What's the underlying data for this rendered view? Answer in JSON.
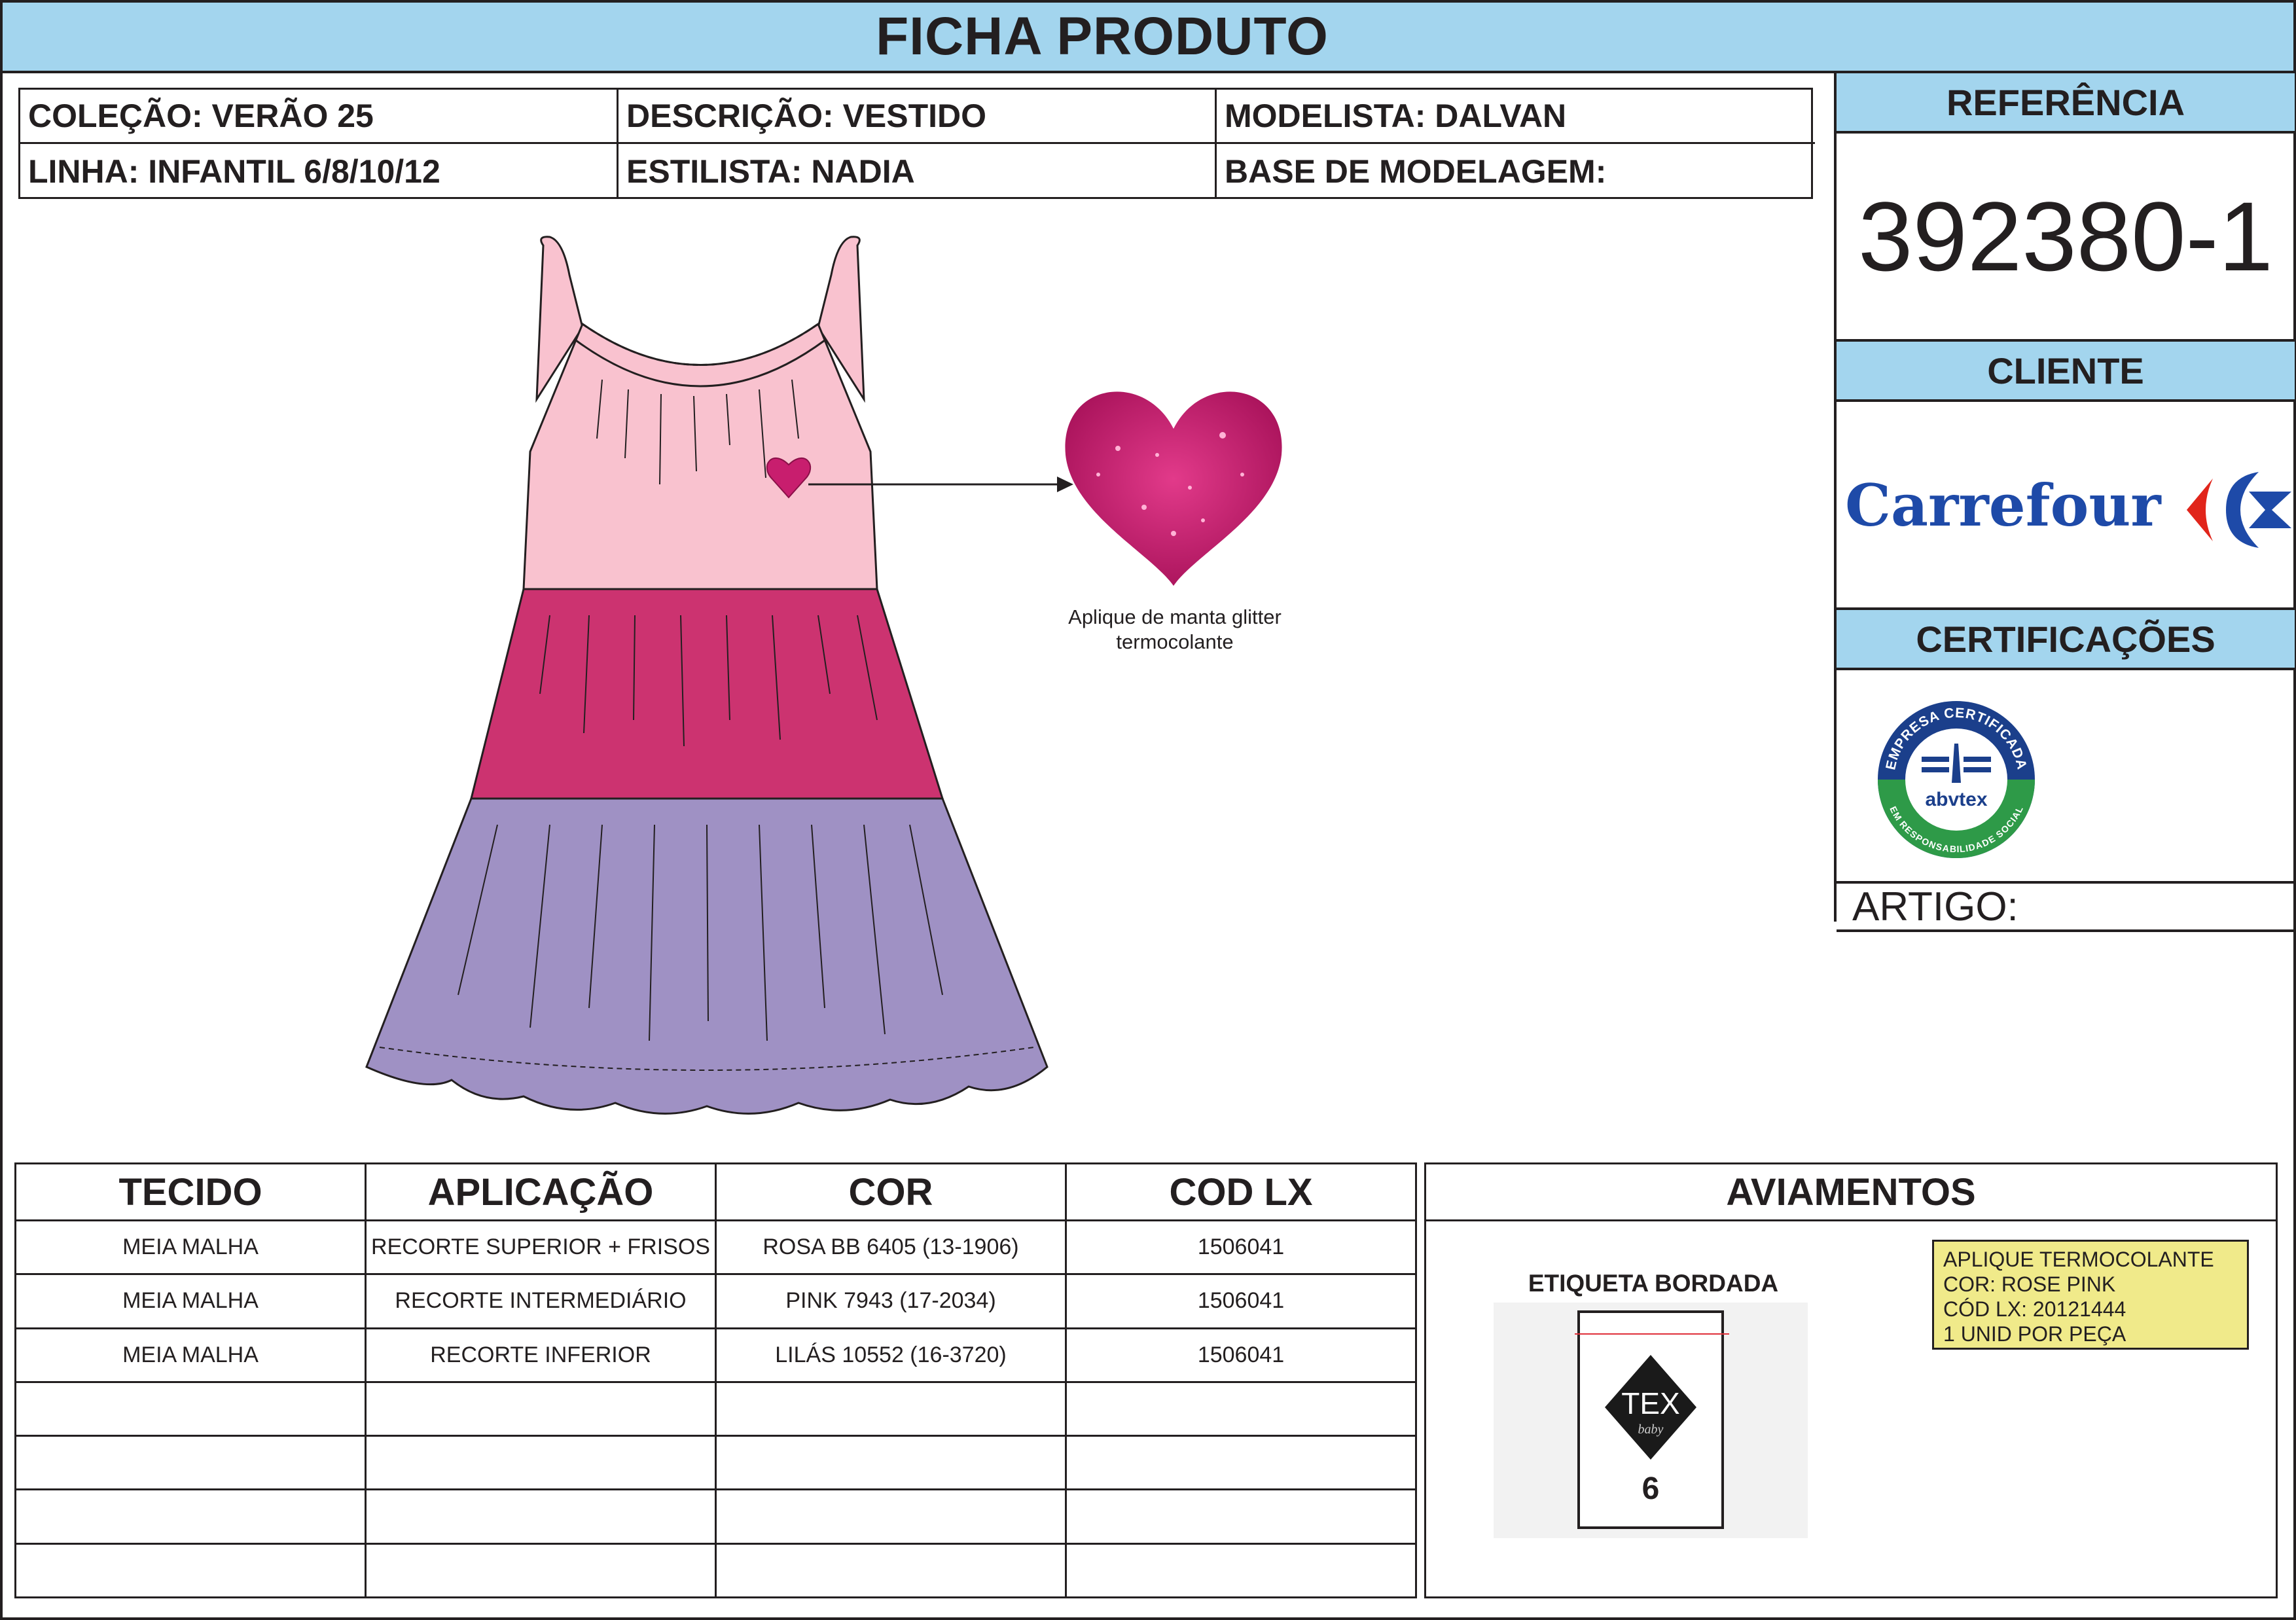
{
  "header": {
    "title": "FICHA PRODUTO"
  },
  "info": {
    "colecao": "COLEÇÃO: VERÃO 25",
    "descricao": "DESCRIÇÃO: VESTIDO",
    "modelista": "MODELISTA: DALVAN",
    "linha": "LINHA: INFANTIL 6/8/10/12",
    "estilista": "ESTILISTA: NADIA",
    "base": "BASE DE MODELAGEM:"
  },
  "side": {
    "referencia_label": "REFERÊNCIA",
    "referencia_value": "392380-1",
    "cliente_label": "CLIENTE",
    "cliente_logo_text": "Carrefour",
    "certificacoes_label": "CERTIFICAÇÕES",
    "seal_top": "EMPRESA CERTIFICADA",
    "seal_bottom": "EM RESPONSABILIDADE SOCIAL",
    "seal_brand": "abvtex",
    "artigo_label": "ARTIGO:"
  },
  "illustration": {
    "caption_line1": "Aplique de manta glitter",
    "caption_line2": "termocolante",
    "colors": {
      "top": "#f9c2cf",
      "middle": "#cc3370",
      "bottom": "#9f91c4",
      "heart": "#c81e6e"
    }
  },
  "fabric_table": {
    "headers": [
      "TECIDO",
      "APLICAÇÃO",
      "COR",
      "COD LX"
    ],
    "rows": [
      [
        "MEIA MALHA",
        "RECORTE SUPERIOR + FRISOS",
        "ROSA BB 6405 (13-1906)",
        "1506041"
      ],
      [
        "MEIA MALHA",
        "RECORTE INTERMEDIÁRIO",
        "PINK 7943 (17-2034)",
        "1506041"
      ],
      [
        "MEIA MALHA",
        "RECORTE INFERIOR",
        "LILÁS 10552 (16-3720)",
        "1506041"
      ],
      [
        "",
        "",
        "",
        ""
      ],
      [
        "",
        "",
        "",
        ""
      ],
      [
        "",
        "",
        "",
        ""
      ],
      [
        "",
        "",
        "",
        ""
      ]
    ]
  },
  "aviamentos": {
    "title": "AVIAMENTOS",
    "note": [
      "APLIQUE TERMOCOLANTE",
      "COR: ROSE PINK",
      "CÓD LX: 20121444",
      "1 UNID POR PEÇA"
    ],
    "etiqueta_label": "ETIQUETA BORDADA",
    "label_brand": "TEX",
    "label_sub": "baby",
    "label_size": "6"
  }
}
